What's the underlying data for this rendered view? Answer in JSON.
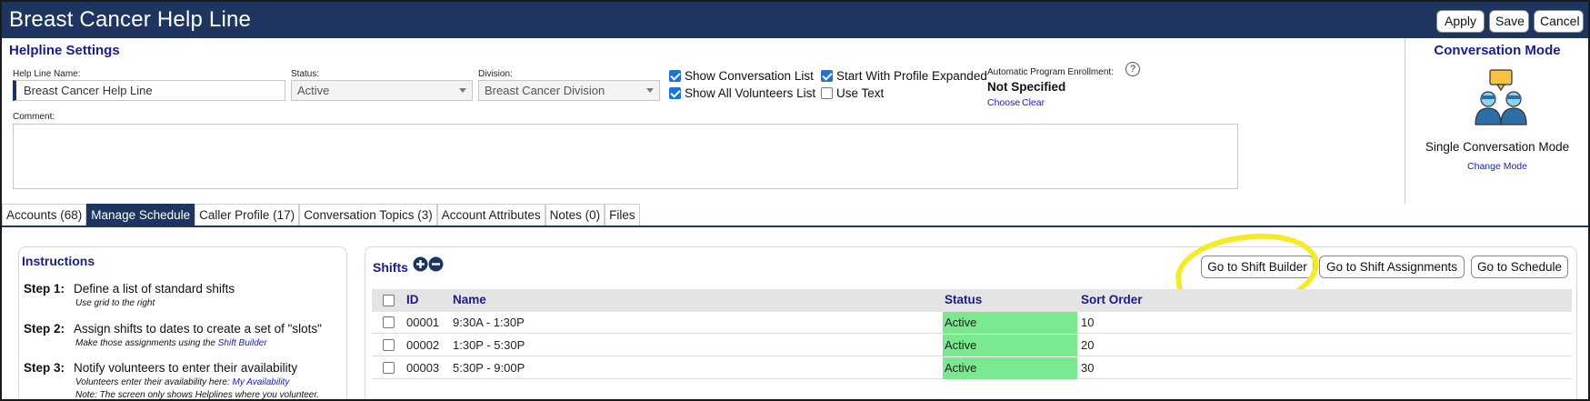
{
  "window": {
    "title": "Breast Cancer Help Line",
    "buttons": {
      "apply": "Apply",
      "save": "Save",
      "cancel": "Cancel"
    }
  },
  "settings": {
    "section_title": "Helpline Settings",
    "help_line_name": {
      "label": "Help Line Name:",
      "value": "Breast Cancer Help Line"
    },
    "status": {
      "label": "Status:",
      "value": "Active"
    },
    "division": {
      "label": "Division:",
      "value": "Breast Cancer Division"
    },
    "checkboxes": {
      "show_conversation_list": {
        "label": "Show Conversation List",
        "checked": true
      },
      "show_all_volunteers_list": {
        "label": "Show All Volunteers List",
        "checked": true
      },
      "start_with_profile_expanded": {
        "label": "Start With Profile Expanded",
        "checked": true
      },
      "use_text": {
        "label": "Use Text",
        "checked": false
      }
    },
    "enrollment": {
      "label": "Automatic Program Enrollment:",
      "help_icon": "question-circle-icon",
      "value": "Not Specified",
      "choose_link": "Choose",
      "clear_link": "Clear"
    },
    "comment": {
      "label": "Comment:",
      "value": ""
    }
  },
  "conversation_mode": {
    "title": "Conversation Mode",
    "icon": "two-users-chat-icon",
    "mode_text": "Single Conversation Mode",
    "change_link": "Change Mode"
  },
  "tabs": [
    {
      "label": "Accounts (68)",
      "active": false
    },
    {
      "label": "Manage Schedule",
      "active": true
    },
    {
      "label": "Caller Profile (17)",
      "active": false
    },
    {
      "label": "Conversation Topics (3)",
      "active": false
    },
    {
      "label": "Account Attributes",
      "active": false
    },
    {
      "label": "Notes (0)",
      "active": false
    },
    {
      "label": "Files",
      "active": false
    }
  ],
  "instructions": {
    "title": "Instructions",
    "steps": [
      {
        "label": "Step 1:",
        "text": "Define a list of standard shifts",
        "sub": "Use grid to the right",
        "sub2": ""
      },
      {
        "label": "Step 2:",
        "text": "Assign shifts to dates to create a set of \"slots\"",
        "sub": "Make those assignments using the",
        "sub_link": "Shift Builder",
        "sub2": ""
      },
      {
        "label": "Step 3:",
        "text": "Notify volunteers to enter their availability",
        "sub": "Volunteers enter their availability here:",
        "sub_link": "My Availability",
        "sub2": "Note: The screen only shows Helplines where you volunteer."
      }
    ]
  },
  "shifts": {
    "title": "Shifts",
    "add_icon": "plus-circle-icon",
    "remove_icon": "minus-circle-icon",
    "buttons": {
      "shift_builder": "Go to Shift Builder",
      "shift_assignments": "Go to Shift Assignments",
      "schedule": "Go to Schedule"
    },
    "columns": {
      "id": "ID",
      "name": "Name",
      "status": "Status",
      "sort_order": "Sort Order"
    },
    "rows": [
      {
        "id": "00001",
        "name": "9:30A - 1:30P",
        "status": "Active",
        "sort_order": "10"
      },
      {
        "id": "00002",
        "name": "1:30P - 5:30P",
        "status": "Active",
        "sort_order": "20"
      },
      {
        "id": "00003",
        "name": "5:30P - 9:00P",
        "status": "Active",
        "sort_order": "30"
      }
    ],
    "status_color": "#7ae88e",
    "annotation_color": "#f4ea25"
  },
  "colors": {
    "header": "#1e3560",
    "section_title": "#1b1b8c",
    "link": "#1b1bbf"
  }
}
